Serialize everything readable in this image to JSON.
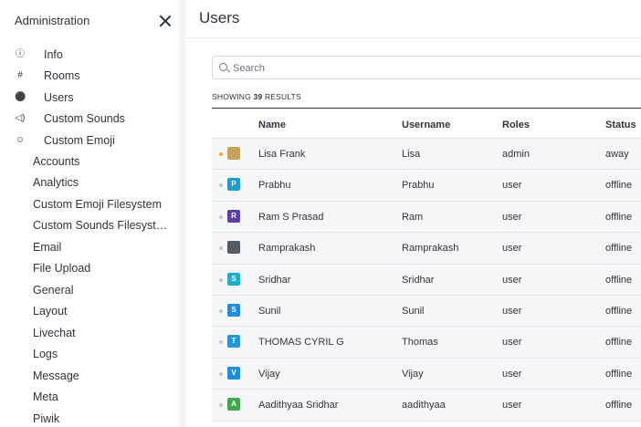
{
  "sidebar": {
    "title": "Administration",
    "main_items": [
      {
        "label": "Info",
        "icon": "info-icon"
      },
      {
        "label": "Rooms",
        "icon": "hash-icon"
      },
      {
        "label": "Users",
        "icon": "team-icon"
      },
      {
        "label": "Custom Sounds",
        "icon": "volume-icon"
      },
      {
        "label": "Custom Emoji",
        "icon": "emoji-icon"
      }
    ],
    "sub_items": [
      "Accounts",
      "Analytics",
      "Custom Emoji Filesystem",
      "Custom Sounds Filesyst…",
      "Email",
      "File Upload",
      "General",
      "Layout",
      "Livechat",
      "Logs",
      "Message",
      "Meta",
      "Piwik"
    ]
  },
  "main": {
    "title": "Users",
    "search": {
      "placeholder": "Search",
      "value": ""
    },
    "results": {
      "prefix": "SHOWING",
      "count": "39",
      "suffix": "RESULTS"
    },
    "columns": {
      "name": "Name",
      "username": "Username",
      "roles": "Roles",
      "status": "Status"
    },
    "users": [
      {
        "name": "Lisa Frank",
        "username": "Lisa",
        "role": "admin",
        "status": "away",
        "avatar_letter": "",
        "avatar_color": "#c8a15a",
        "dot_color": "#f5a623"
      },
      {
        "name": "Prabhu",
        "username": "Prabhu",
        "role": "user",
        "status": "offline",
        "avatar_letter": "P",
        "avatar_color": "#1d9bd4",
        "dot_color": "#c5c8ce"
      },
      {
        "name": "Ram S Prasad",
        "username": "Ram",
        "role": "user",
        "status": "offline",
        "avatar_letter": "R",
        "avatar_color": "#5c3fa8",
        "dot_color": "#c5c8ce"
      },
      {
        "name": "Ramprakash",
        "username": "Ramprakash",
        "role": "user",
        "status": "offline",
        "avatar_letter": "",
        "avatar_color": "#555b63",
        "dot_color": "#c5c8ce"
      },
      {
        "name": "Sridhar",
        "username": "Sridhar",
        "role": "user",
        "status": "offline",
        "avatar_letter": "S",
        "avatar_color": "#17b0d0",
        "dot_color": "#c5c8ce"
      },
      {
        "name": "Sunil",
        "username": "Sunil",
        "role": "user",
        "status": "offline",
        "avatar_letter": "S",
        "avatar_color": "#1d8fe0",
        "dot_color": "#c5c8ce"
      },
      {
        "name": "THOMAS CYRIL G",
        "username": "Thomas",
        "role": "user",
        "status": "offline",
        "avatar_letter": "T",
        "avatar_color": "#1d9bd4",
        "dot_color": "#c5c8ce"
      },
      {
        "name": "Vijay",
        "username": "Vijay",
        "role": "user",
        "status": "offline",
        "avatar_letter": "V",
        "avatar_color": "#1d8fe0",
        "dot_color": "#c5c8ce"
      },
      {
        "name": "Aadithyaa Sridhar",
        "username": "aadithyaa",
        "role": "user",
        "status": "offline",
        "avatar_letter": "A",
        "avatar_color": "#3fa84a",
        "dot_color": "#c5c8ce"
      }
    ]
  }
}
